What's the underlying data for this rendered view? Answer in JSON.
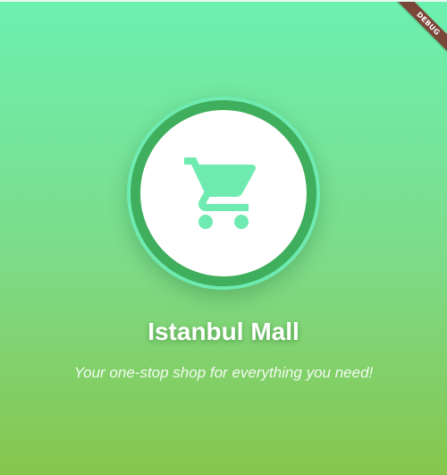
{
  "debug_banner": {
    "label": "DEBUG"
  },
  "logo": {
    "icon": "shopping-cart-icon",
    "icon_color": "#6feab0",
    "ring_color": "#6feab0",
    "background_color": "#ffffff"
  },
  "app": {
    "title": "Istanbul Mall",
    "tagline": "Your one-stop shop for everything you need!"
  },
  "colors": {
    "gradient_top": "#6cf0b0",
    "gradient_bottom": "#86c64d",
    "text": "#ffffff"
  }
}
